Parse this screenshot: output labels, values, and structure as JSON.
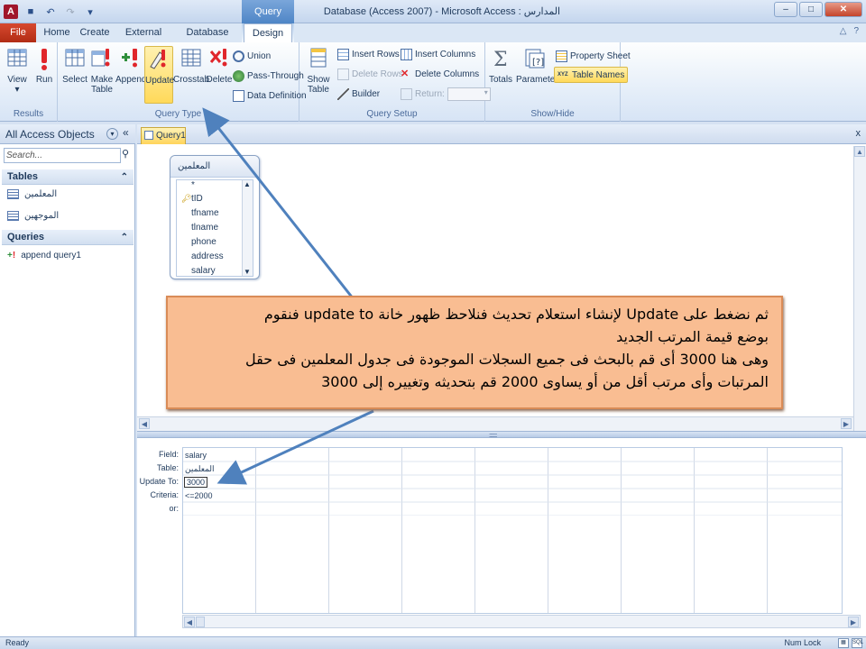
{
  "window": {
    "title": "Database (Access 2007) - Microsoft Access : المدارس",
    "context_tools": "Query Tools",
    "app_icon": "A"
  },
  "tabs": [
    "File",
    "Home",
    "Create",
    "External Data",
    "Database Tools",
    "Design"
  ],
  "ribbon": {
    "results": {
      "label": "Results",
      "view": "View",
      "run": "Run"
    },
    "query_type": {
      "label": "Query Type",
      "select": "Select",
      "make_table_1": "Make",
      "make_table_2": "Table",
      "append": "Append",
      "update": "Update",
      "crosstab": "Crosstab",
      "delete": "Delete",
      "union": "Union",
      "pass_through": "Pass-Through",
      "data_definition": "Data Definition"
    },
    "query_setup": {
      "label": "Query Setup",
      "show_table_1": "Show",
      "show_table_2": "Table",
      "insert_rows": "Insert Rows",
      "delete_rows": "Delete Rows",
      "builder": "Builder",
      "insert_columns": "Insert Columns",
      "delete_columns": "Delete Columns",
      "return": "Return:"
    },
    "show_hide": {
      "label": "Show/Hide",
      "totals": "Totals",
      "parameters": "Parameters",
      "property_sheet": "Property Sheet",
      "table_names": "Table Names"
    }
  },
  "nav": {
    "title": "All Access Objects",
    "search_placeholder": "Search...",
    "groups": [
      {
        "name": "Tables",
        "items": [
          "المعلمين",
          "الموجهين"
        ]
      },
      {
        "name": "Queries",
        "items": [
          "append query1"
        ]
      }
    ]
  },
  "document": {
    "tab": "Query1",
    "field_list": {
      "title": "المعلمين",
      "fields": [
        "*",
        "tID",
        "tfname",
        "tlname",
        "phone",
        "address",
        "salary"
      ]
    },
    "grid": {
      "row_labels": [
        "Field:",
        "Table:",
        "Update To:",
        "Criteria:",
        "or:"
      ],
      "column1": {
        "field": "salary",
        "table": "المعلمين",
        "update_to": "3000",
        "criteria": "<=2000"
      }
    }
  },
  "callout": {
    "line1": "ثم نضغط على Update لإنشاء استعلام تحديث فنلاحظ ظهور خانة update to فنقوم",
    "line2": "بوضع قيمة المرتب الجديد",
    "line3": "وهى هنا 3000 أى قم بالبحث فى جميع السجلات الموجودة فى جدول المعلمين فى حقل",
    "line4": "المرتبات وأى مرتب أقل من أو يساوى 2000 قم بتحديثه وتغييره إلى 3000"
  },
  "status": {
    "left": "Ready",
    "numlock": "Num Lock",
    "sql": "SQL"
  },
  "colors": {
    "accent_file": "#b12c14",
    "active_button": "#ffd95a",
    "callout_fill": "#f9bd92",
    "arrow": "#4f81bd"
  }
}
